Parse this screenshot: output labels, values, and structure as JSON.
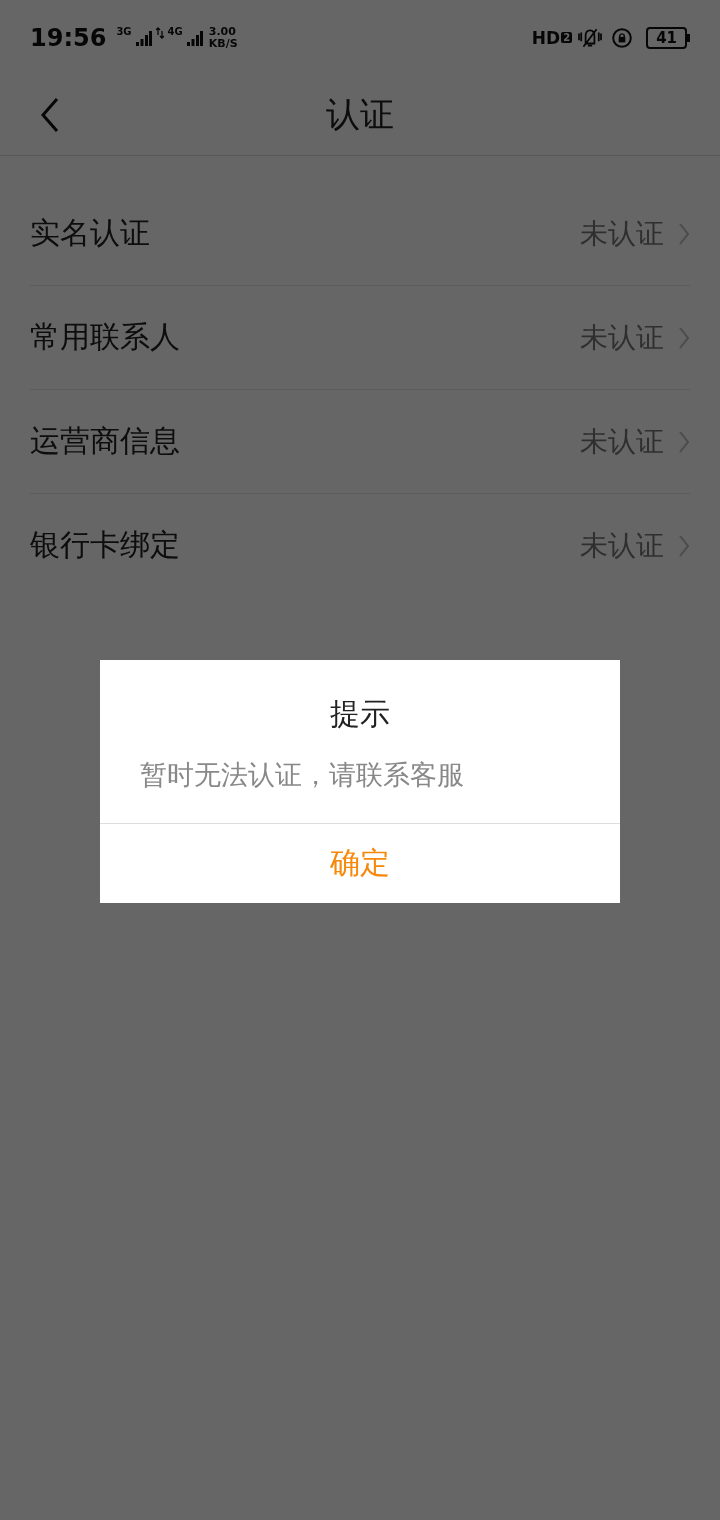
{
  "status_bar": {
    "time": "19:56",
    "network_1": "3G",
    "network_2": "4G",
    "speed_value": "3.00",
    "speed_unit": "KB/S",
    "hd_label": "HD",
    "hd_index": "2",
    "battery": "41"
  },
  "nav": {
    "title": "认证"
  },
  "items": [
    {
      "label": "实名认证",
      "status": "未认证"
    },
    {
      "label": "常用联系人",
      "status": "未认证"
    },
    {
      "label": "运营商信息",
      "status": "未认证"
    },
    {
      "label": "银行卡绑定",
      "status": "未认证"
    }
  ],
  "dialog": {
    "title": "提示",
    "message": "暂时无法认证，请联系客服",
    "button": "确定"
  }
}
